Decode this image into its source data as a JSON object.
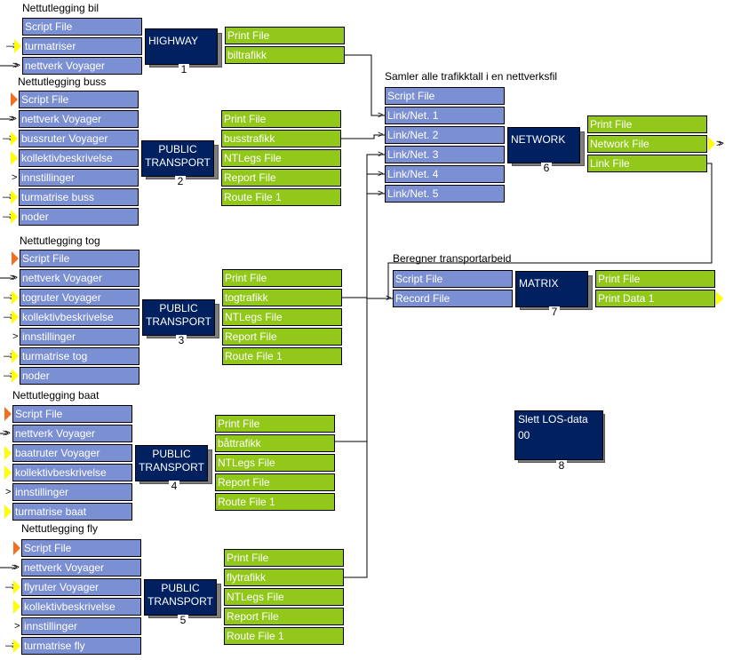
{
  "colors": {
    "input": "#7b8fd3",
    "output": "#92c81a",
    "program": "#002060",
    "shadow": "#7f7f7f",
    "marker_yellow": "#ffff00",
    "marker_orange": "#f07020"
  },
  "groups": [
    {
      "title": "Nettutlegging bil",
      "box": [
        "HIGHWAY"
      ],
      "number": "1",
      "inputs": [
        {
          "label": "Script File",
          "marker": "none"
        },
        {
          "label": "turmatriser",
          "marker": "yellow-double-arrow"
        },
        {
          "label": "nettverk Voyager",
          "marker": "double-arrow"
        }
      ],
      "outputs": [
        "Print File",
        "biltrafikk"
      ]
    },
    {
      "title": "Nettutlegging buss",
      "box": [
        "PUBLIC",
        "TRANSPORT"
      ],
      "number": "2",
      "inputs": [
        {
          "label": "Script File",
          "marker": "orange"
        },
        {
          "label": "nettverk Voyager",
          "marker": "double-arrow"
        },
        {
          "label": "bussruter Voyager",
          "marker": "yellow-double-arrow"
        },
        {
          "label": "kollektivbeskrivelse",
          "marker": "yellow"
        },
        {
          "label": "innstillinger",
          "marker": "arrow"
        },
        {
          "label": "turmatrise buss",
          "marker": "yellow-double-arrow"
        },
        {
          "label": "noder",
          "marker": "yellow-double-arrow"
        }
      ],
      "outputs": [
        "Print File",
        "busstrafikk",
        "NTLegs File",
        "Report File",
        "Route File 1"
      ]
    },
    {
      "title": "Nettutlegging tog",
      "box": [
        "PUBLIC",
        "TRANSPORT"
      ],
      "number": "3",
      "inputs": [
        {
          "label": "Script File",
          "marker": "orange"
        },
        {
          "label": "nettverk Voyager",
          "marker": "double-arrow"
        },
        {
          "label": "togruter Voyager",
          "marker": "yellow-double-arrow"
        },
        {
          "label": "kollektivbeskrivelse",
          "marker": "yellow-double-arrow"
        },
        {
          "label": "innstillinger",
          "marker": "arrow"
        },
        {
          "label": "turmatrise tog",
          "marker": "yellow-double-arrow"
        },
        {
          "label": "noder",
          "marker": "yellow-double-arrow"
        }
      ],
      "outputs": [
        "Print File",
        "togtrafikk",
        "NTLegs File",
        "Report File",
        "Route File 1"
      ]
    },
    {
      "title": "Nettutlegging baat",
      "box": [
        "PUBLIC",
        "TRANSPORT"
      ],
      "number": "4",
      "inputs": [
        {
          "label": "Script File",
          "marker": "orange"
        },
        {
          "label": "nettverk Voyager",
          "marker": "double-arrow"
        },
        {
          "label": "baatruter Voyager",
          "marker": "yellow"
        },
        {
          "label": "kollektivbeskrivelse",
          "marker": "yellow"
        },
        {
          "label": "innstillinger",
          "marker": "arrow"
        },
        {
          "label": "turmatrise baat",
          "marker": "yellow"
        }
      ],
      "outputs": [
        "Print File",
        "båttrafikk",
        "NTLegs File",
        "Report File",
        "Route File 1"
      ]
    },
    {
      "title": "Nettutlegging fly",
      "box": [
        "PUBLIC",
        "TRANSPORT"
      ],
      "number": "5",
      "inputs": [
        {
          "label": "Script File",
          "marker": "orange"
        },
        {
          "label": "nettverk Voyager",
          "marker": "double-arrow"
        },
        {
          "label": "flyruter Voyager",
          "marker": "yellow-double-arrow"
        },
        {
          "label": "kollektivbeskrivelse",
          "marker": "yellow"
        },
        {
          "label": "innstillinger",
          "marker": "arrow"
        },
        {
          "label": "turmatrise fly",
          "marker": "yellow-double-arrow"
        }
      ],
      "outputs": [
        "Print File",
        "flytrafikk",
        "NTLegs File",
        "Report File",
        "Route File 1"
      ]
    },
    {
      "title": "Samler alle trafikktall i en nettverksfil",
      "box": [
        "NETWORK"
      ],
      "number": "6",
      "inputs": [
        {
          "label": "Script File",
          "marker": "none"
        },
        {
          "label": "Link/Net. 1",
          "marker": "arrow"
        },
        {
          "label": "Link/Net. 2",
          "marker": "arrow"
        },
        {
          "label": "Link/Net. 3",
          "marker": "arrow"
        },
        {
          "label": "Link/Net. 4",
          "marker": "arrow"
        },
        {
          "label": "Link/Net. 5",
          "marker": "arrow"
        }
      ],
      "outputs": [
        "Print File",
        "Network File",
        "Link File"
      ]
    },
    {
      "title": "Beregner transportarbeid",
      "box": [
        "MATRIX"
      ],
      "number": "7",
      "inputs": [
        {
          "label": "Script File",
          "marker": "none"
        },
        {
          "label": "Record File",
          "marker": "arrow"
        }
      ],
      "outputs": [
        "Print File",
        "Print Data 1"
      ]
    }
  ],
  "standalone": {
    "box": [
      "Slett LOS-data",
      "00"
    ],
    "number": "8"
  }
}
